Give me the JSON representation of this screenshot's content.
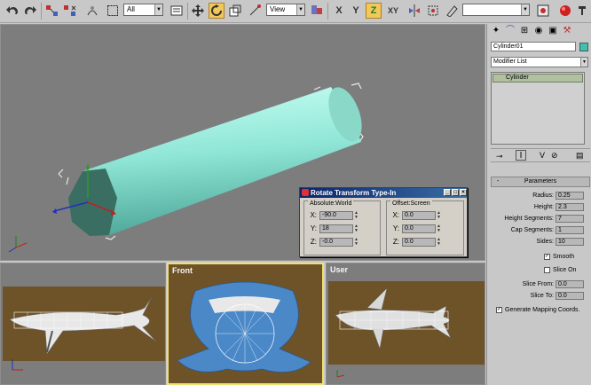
{
  "toolbar": {
    "selection_filter": "All",
    "reference_coord": "View",
    "axis_x_label": "X",
    "axis_y_label": "Y",
    "axis_z_label": "Z",
    "axis_xy_label": "XY",
    "named_selection": ""
  },
  "viewports": {
    "front_label": "Front",
    "user_label": "User"
  },
  "dialog": {
    "title": "Rotate Transform Type-In",
    "absolute_group": "Absolute:World",
    "offset_group": "Offset:Screen",
    "abs_x_label": "X:",
    "abs_y_label": "Y:",
    "abs_z_label": "Z:",
    "abs_x": "-90.0",
    "abs_y": "18",
    "abs_z": "-0.0",
    "off_x_label": "X:",
    "off_y_label": "Y:",
    "off_z_label": "Z:",
    "off_x": "0.0",
    "off_y": "0.0",
    "off_z": "0.0"
  },
  "command_panel": {
    "object_name": "Cylinder01",
    "object_color": "#40c0b0",
    "modifier_list": "Modifier List",
    "stack_item": "Cylinder",
    "rollout_title": "Parameters",
    "radius_label": "Radius:",
    "radius": "0.25",
    "height_label": "Height:",
    "height": "2.3",
    "height_segments_label": "Height Segments:",
    "height_segments": "7",
    "cap_segments_label": "Cap Segments:",
    "cap_segments": "1",
    "sides_label": "Sides:",
    "sides": "10",
    "smooth_label": "Smooth",
    "slice_on_label": "Slice On",
    "slice_from_label": "Slice From:",
    "slice_from": "0.0",
    "slice_to_label": "Slice To:",
    "slice_to": "0.0",
    "gen_mapping_label": "Generate Mapping Coords."
  }
}
